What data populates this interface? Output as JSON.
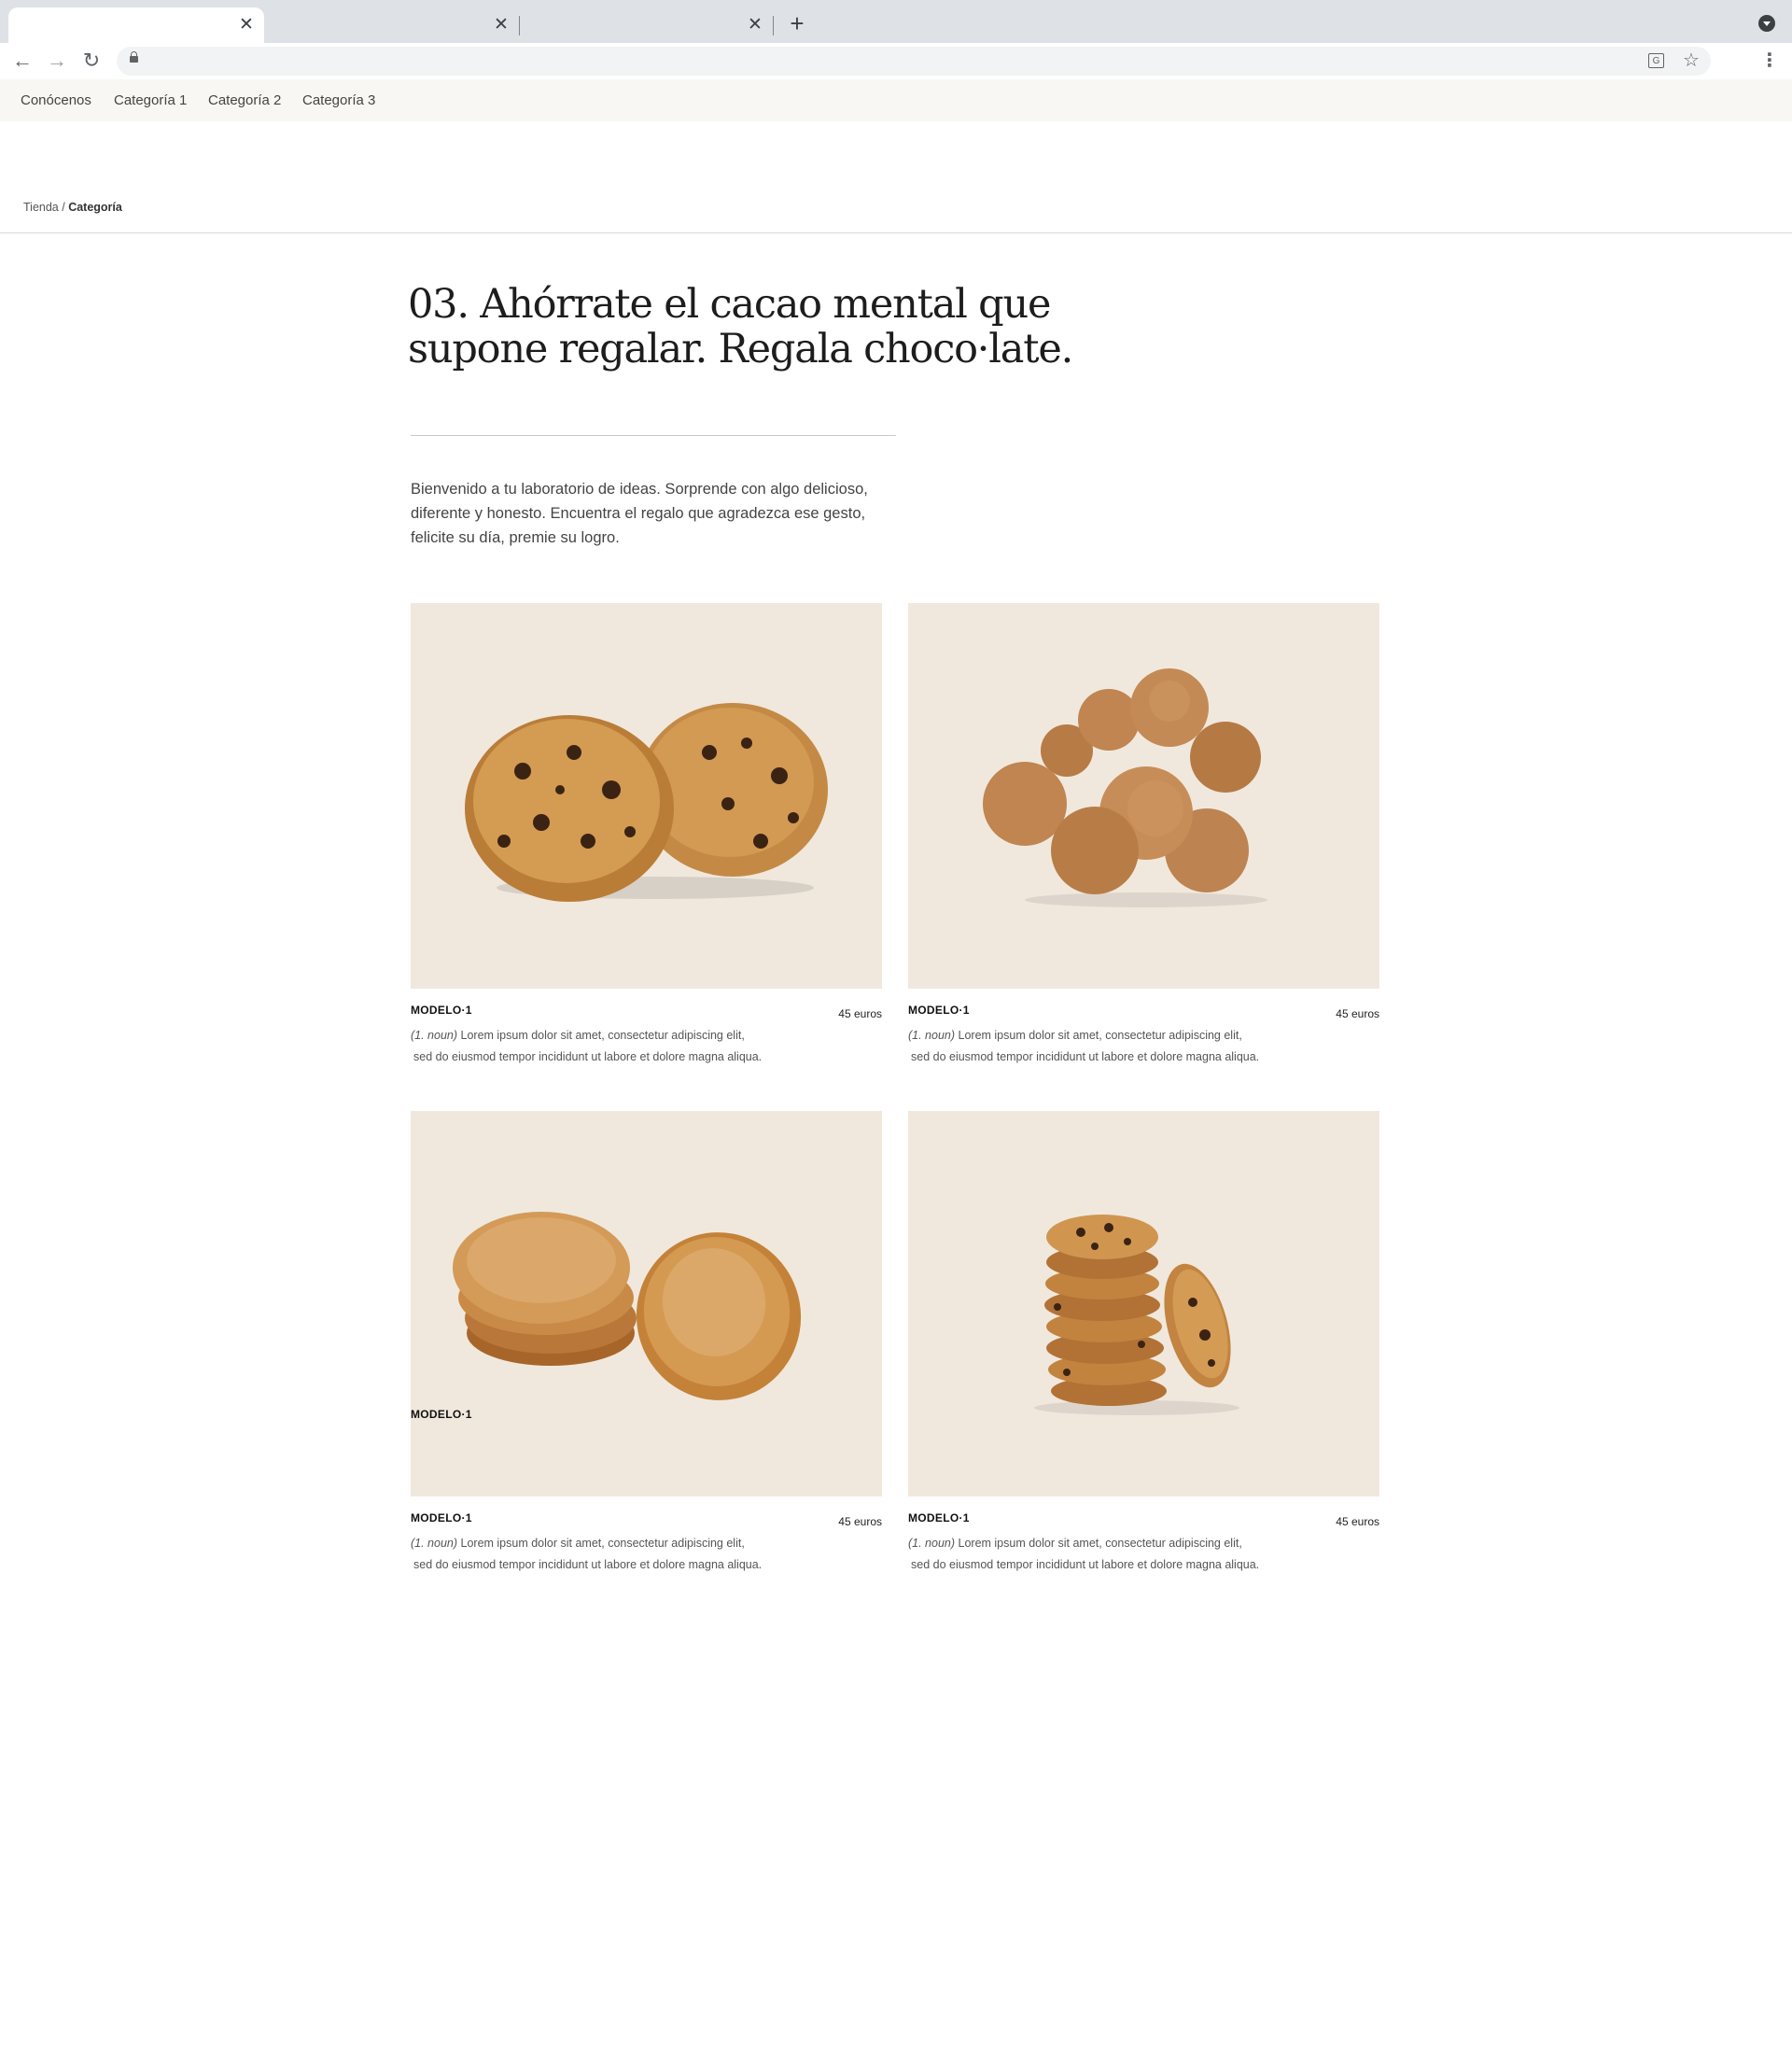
{
  "browser": {
    "tabs": [
      {
        "title": "",
        "active": true
      },
      {
        "title": "",
        "active": false
      },
      {
        "title": "",
        "active": false
      }
    ],
    "address": "",
    "icons": {
      "tab_close": "close-icon",
      "new_tab": "plus-icon",
      "tab_search": "chevron-down-icon",
      "back": "arrow-left-icon",
      "forward": "arrow-right-icon",
      "reload": "reload-icon",
      "lock": "lock-icon",
      "translate": "translate-icon",
      "bookmark": "star-icon",
      "menu": "kebab-menu-icon"
    }
  },
  "nav": {
    "items": [
      {
        "label": "Conócenos"
      },
      {
        "label": "Categoría 1"
      },
      {
        "label": "Categoría 2"
      },
      {
        "label": "Categoría 3"
      }
    ]
  },
  "breadcrumb": {
    "root": "Tienda",
    "separator": " / ",
    "current": "Categoría"
  },
  "hero": {
    "title_lines": [
      "03. Ahórrate el cacao mental que",
      "supone regalar. Regala choco·late."
    ],
    "intro_lines": [
      "Bienvenido a tu laboratorio de ideas. Sorprende con algo delicioso,",
      "diferente y honesto. Encuentra el regalo que agradezca ese gesto,",
      "felicite su día, premie su logro."
    ]
  },
  "products": [
    {
      "name": "MODELO·1",
      "price": "45 euros",
      "noun": "(1. noun)",
      "desc_line1": " Lorem ipsum dolor sit amet, consectetur adipiscing elit,",
      "desc_line2": "sed do eiusmod tempor incididunt ut labore et dolore magna aliqua.",
      "image": "chocolate-chip-cookies-pair"
    },
    {
      "name": "MODELO·1",
      "price": "45 euros",
      "noun": "(1. noun)",
      "desc_line1": " Lorem ipsum dolor sit amet, consectetur adipiscing elit,",
      "desc_line2": "sed do eiusmod tempor incididunt ut labore et dolore magna aliqua.",
      "image": "round-cookie-balls-pile"
    },
    {
      "name": "MODELO·1",
      "price": "45 euros",
      "noun": "(1. noun)",
      "desc_line1": " Lorem ipsum dolor sit amet, consectetur adipiscing elit,",
      "desc_line2": "sed do eiusmod tempor incididunt ut labore et dolore magna aliqua.",
      "image": "sugar-cookies-stack",
      "overlay_label": "MODELO·1"
    },
    {
      "name": "MODELO·1",
      "price": "45 euros",
      "noun": "(1. noun)",
      "desc_line1": " Lorem ipsum dolor sit amet, consectetur adipiscing elit,",
      "desc_line2": "sed do eiusmod tempor incididunt ut labore et dolore magna aliqua.",
      "image": "chocolate-chip-cookie-tower"
    }
  ],
  "colors": {
    "tabstrip": "#dee1e6",
    "site_nav_bg": "#f8f7f3",
    "card_bg": "#f0e8dd",
    "cookie": "#c98d42",
    "chocolate": "#3b2314"
  }
}
